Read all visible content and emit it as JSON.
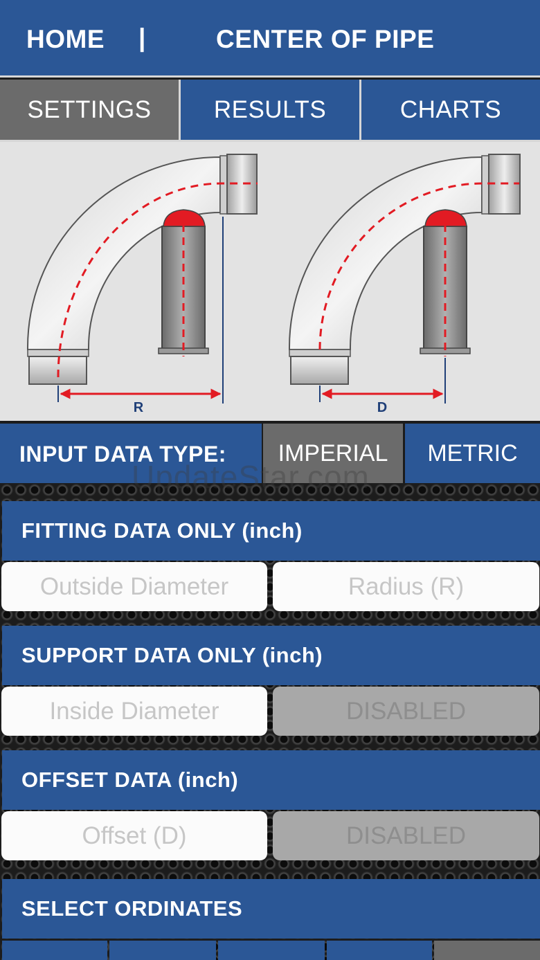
{
  "header": {
    "home": "HOME",
    "separator": "|",
    "title": "CENTER OF PIPE"
  },
  "tabs": [
    {
      "label": "SETTINGS",
      "active": true
    },
    {
      "label": "RESULTS",
      "active": false
    },
    {
      "label": "CHARTS",
      "active": false
    }
  ],
  "diagram": {
    "left_label": "R",
    "right_label": "D"
  },
  "input_type": {
    "label": "INPUT DATA TYPE:",
    "imperial": "IMPERIAL",
    "metric": "METRIC",
    "selected": "IMPERIAL"
  },
  "watermark": "UpdateStar.com",
  "sections": {
    "fitting": {
      "title": "FITTING DATA ONLY (inch)",
      "field1_placeholder": "Outside Diameter",
      "field2_placeholder": "Radius (R)"
    },
    "support": {
      "title": "SUPPORT DATA ONLY (inch)",
      "field1_placeholder": "Inside Diameter",
      "field2_placeholder": "DISABLED"
    },
    "offset": {
      "title": "OFFSET DATA (inch)",
      "field1_placeholder": "Offset (D)",
      "field2_placeholder": "DISABLED"
    },
    "ordinates": {
      "title": "SELECT ORDINATES"
    }
  },
  "colors": {
    "primary_blue": "#2b5796",
    "active_grey": "#6b6b6b",
    "dim_red": "#e21b23",
    "dim_line_blue": "#1f3f78"
  }
}
